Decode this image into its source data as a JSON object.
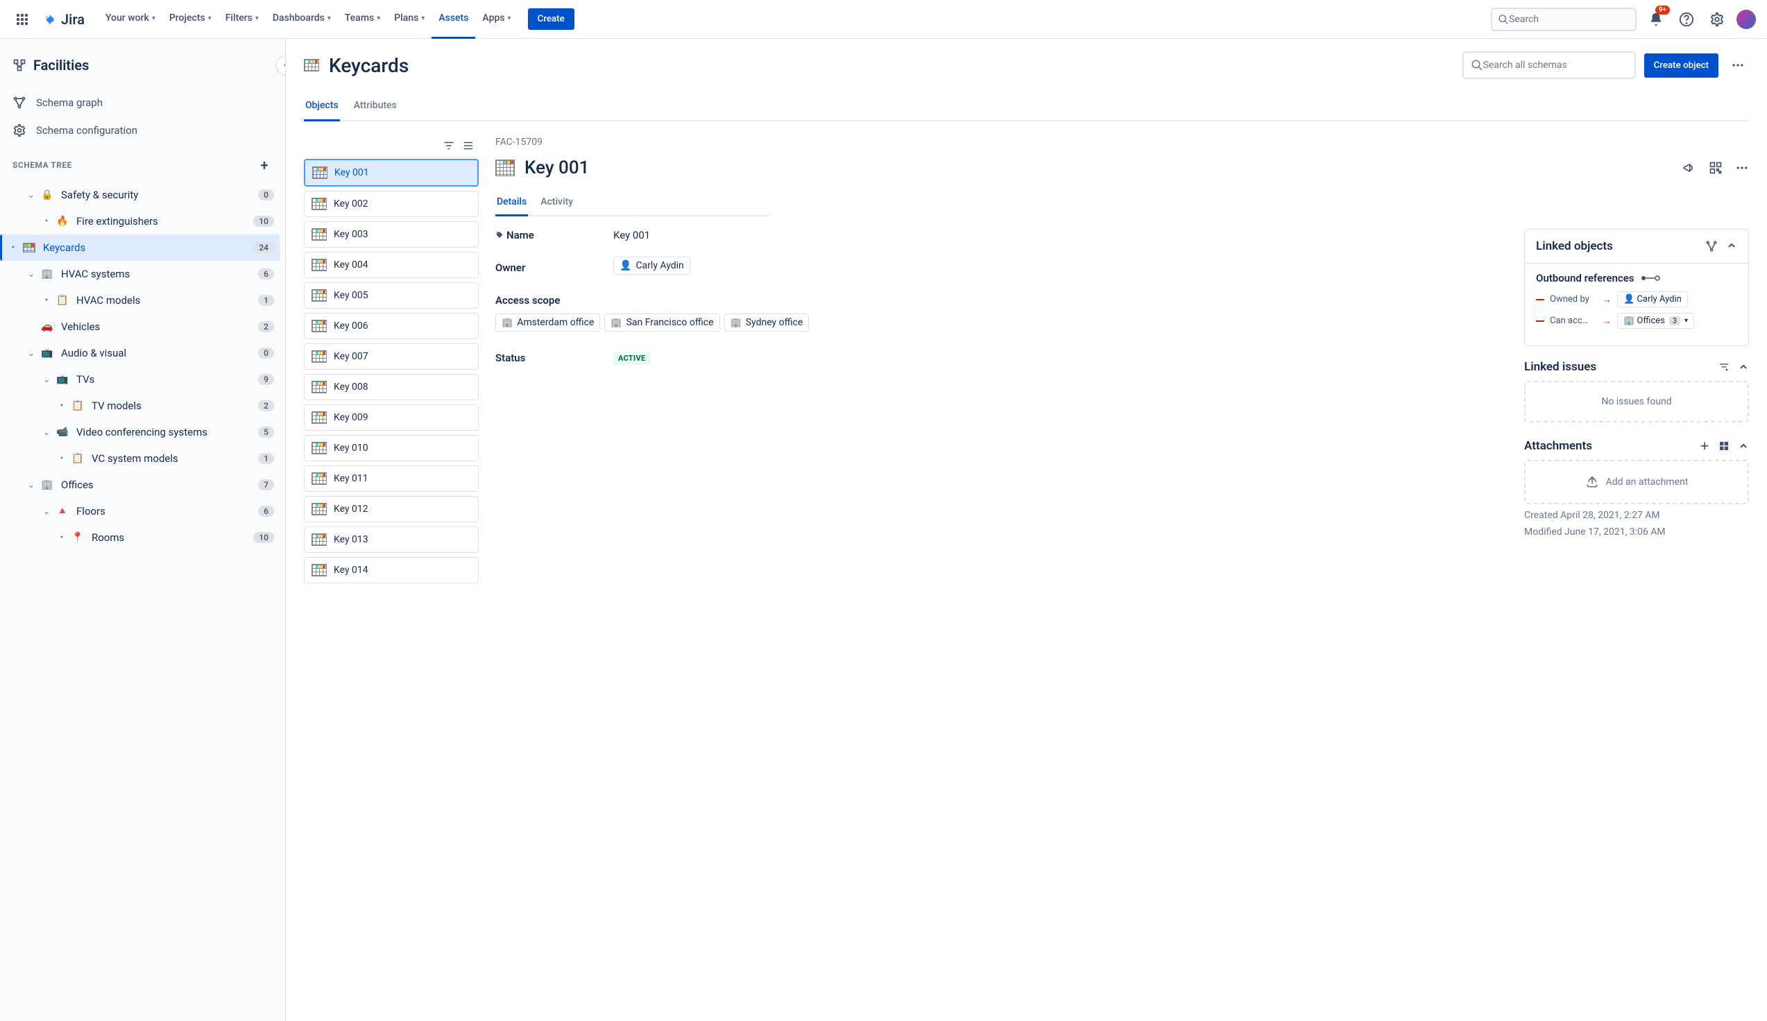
{
  "topnav": {
    "product": "Jira",
    "items": [
      {
        "label": "Your work",
        "chev": true
      },
      {
        "label": "Projects",
        "chev": true
      },
      {
        "label": "Filters",
        "chev": true
      },
      {
        "label": "Dashboards",
        "chev": true
      },
      {
        "label": "Teams",
        "chev": true
      },
      {
        "label": "Plans",
        "chev": true
      },
      {
        "label": "Assets",
        "chev": false,
        "active": true
      },
      {
        "label": "Apps",
        "chev": true
      }
    ],
    "create": "Create",
    "search_placeholder": "Search",
    "notif_badge": "9+"
  },
  "sidebar": {
    "title": "Facilities",
    "links": [
      {
        "label": "Schema graph"
      },
      {
        "label": "Schema configuration"
      }
    ],
    "tree_heading": "SCHEMA TREE",
    "tree": [
      {
        "label": "Safety & security",
        "count": "0",
        "depth": 1,
        "exp": true,
        "icon": "🔒"
      },
      {
        "label": "Fire extinguishers",
        "count": "10",
        "depth": 2,
        "bullet": true,
        "icon": "🔥"
      },
      {
        "label": "Keycards",
        "count": "24",
        "depth": 2,
        "bullet": true,
        "selected": true,
        "iconGrid": true
      },
      {
        "label": "HVAC systems",
        "count": "6",
        "depth": 1,
        "exp": true,
        "icon": "🏢"
      },
      {
        "label": "HVAC models",
        "count": "1",
        "depth": 2,
        "bullet": true,
        "icon": "📋"
      },
      {
        "label": "Vehicles",
        "count": "2",
        "depth": 1,
        "noexp": true,
        "icon": "🚗"
      },
      {
        "label": "Audio & visual",
        "count": "0",
        "depth": 1,
        "exp": true,
        "icon": "📺"
      },
      {
        "label": "TVs",
        "count": "9",
        "depth": 2,
        "exp": true,
        "icon": "📺"
      },
      {
        "label": "TV models",
        "count": "2",
        "depth": 3,
        "bullet": true,
        "icon": "📋"
      },
      {
        "label": "Video conferencing systems",
        "count": "5",
        "depth": 2,
        "exp": true,
        "icon": "📹"
      },
      {
        "label": "VC system models",
        "count": "1",
        "depth": 3,
        "bullet": true,
        "icon": "📋"
      },
      {
        "label": "Offices",
        "count": "7",
        "depth": 1,
        "exp": true,
        "icon": "🏢"
      },
      {
        "label": "Floors",
        "count": "6",
        "depth": 2,
        "exp": true,
        "icon": "🔺"
      },
      {
        "label": "Rooms",
        "count": "10",
        "depth": 3,
        "bullet": true,
        "icon": "📍"
      }
    ]
  },
  "page": {
    "title": "Keycards",
    "search_placeholder": "Search all schemas",
    "create_object": "Create object",
    "tabs": [
      {
        "label": "Objects",
        "active": true
      },
      {
        "label": "Attributes"
      }
    ]
  },
  "objects": [
    {
      "label": "Key 001",
      "selected": true
    },
    {
      "label": "Key 002"
    },
    {
      "label": "Key 003"
    },
    {
      "label": "Key 004"
    },
    {
      "label": "Key 005"
    },
    {
      "label": "Key 006"
    },
    {
      "label": "Key 007"
    },
    {
      "label": "Key 008"
    },
    {
      "label": "Key 009"
    },
    {
      "label": "Key 010"
    },
    {
      "label": "Key 011"
    },
    {
      "label": "Key 012"
    },
    {
      "label": "Key 013"
    },
    {
      "label": "Key 014"
    }
  ],
  "detail": {
    "id": "FAC-15709",
    "title": "Key 001",
    "tabs": [
      {
        "label": "Details",
        "active": true
      },
      {
        "label": "Activity"
      }
    ],
    "props": {
      "name_label": "Name",
      "name_value": "Key 001",
      "owner_label": "Owner",
      "owner_value": "Carly Aydin",
      "access_label": "Access scope",
      "access_values": [
        "Amsterdam office",
        "San Francisco office",
        "Sydney office"
      ],
      "status_label": "Status",
      "status_value": "ACTIVE"
    },
    "linked_objects": {
      "title": "Linked objects",
      "outbound_label": "Outbound references",
      "refs": [
        {
          "relation": "Owned by",
          "target": "Carly Aydin",
          "user": true
        },
        {
          "relation": "Can acc…",
          "target": "Offices",
          "count": "3",
          "office": true
        }
      ]
    },
    "linked_issues": {
      "title": "Linked issues",
      "empty": "No issues found"
    },
    "attachments": {
      "title": "Attachments",
      "empty": "Add an attachment"
    },
    "created": "Created April 28, 2021, 2:27 AM",
    "modified": "Modified June 17, 2021, 3:06 AM"
  }
}
